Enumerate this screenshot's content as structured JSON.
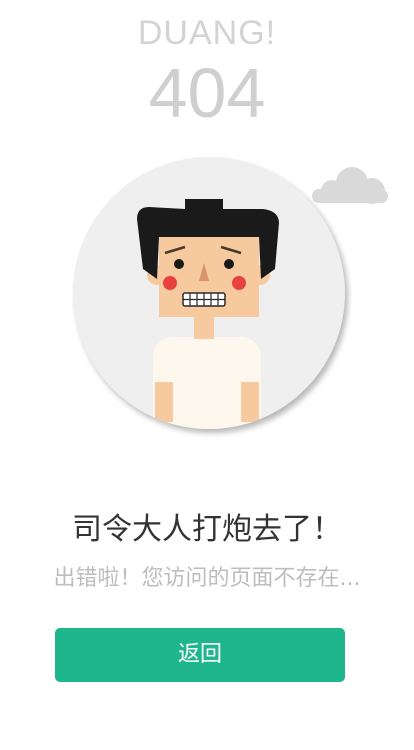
{
  "header": {
    "exclamation": "DUANG!",
    "error_code": "404"
  },
  "message": {
    "title": "司令大人打炮去了！",
    "subtitle": "出错啦！您访问的页面不存在..."
  },
  "actions": {
    "back_label": "返回"
  },
  "colors": {
    "accent": "#1fb68d",
    "muted_text": "#bdbdbd",
    "heading_text": "#333333"
  }
}
